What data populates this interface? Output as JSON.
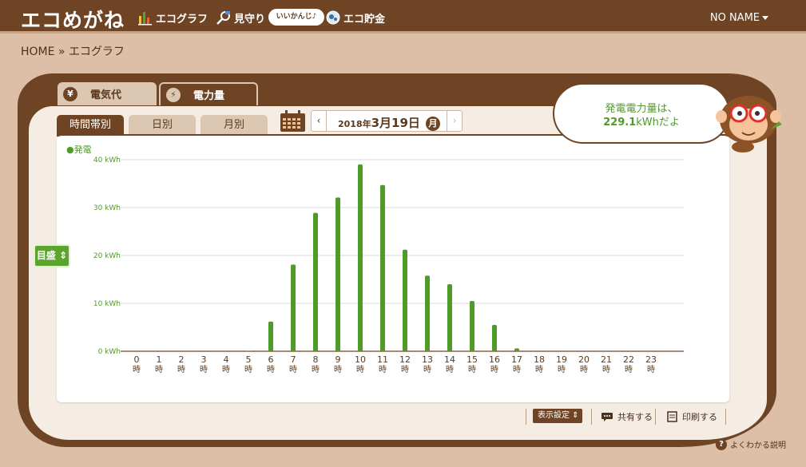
{
  "header": {
    "logo": "エコめがね",
    "nav": [
      {
        "label": "エコグラフ",
        "icon": "bar-chart-icon"
      },
      {
        "label": "見守り",
        "icon": "magnifier-icon"
      },
      {
        "label": "エコ貯金",
        "icon": "piggy-bank-icon"
      }
    ],
    "status_pill": "いいかんじ♪",
    "user": "NO NAME"
  },
  "breadcrumb": "HOME » エコグラフ",
  "main_tabs": [
    {
      "label": "電気代",
      "icon": "yen-icon"
    },
    {
      "label": "電力量",
      "icon": "lightning-icon"
    }
  ],
  "sub_tabs": [
    "時間帯別",
    "日別",
    "月別"
  ],
  "date": {
    "year": "2018年",
    "monthday": "3月19日",
    "dow": "月"
  },
  "bubble": {
    "line1": "発電電力量は、",
    "value": "229.1",
    "unit": "kWh",
    "suffix": "だよ"
  },
  "scale_button": "目盛",
  "colors": {
    "brand": "#6e4424",
    "accent": "#5da42d",
    "bar": "#4f9a28"
  },
  "chart_data": {
    "type": "bar",
    "legend": "●発電",
    "categories": [
      "0",
      "1",
      "2",
      "3",
      "4",
      "5",
      "6",
      "7",
      "8",
      "9",
      "10",
      "11",
      "12",
      "13",
      "14",
      "15",
      "16",
      "17",
      "18",
      "19",
      "20",
      "21",
      "22",
      "23"
    ],
    "category_suffix": "時",
    "series": [
      {
        "name": "発電",
        "values": [
          0,
          0,
          0,
          0,
          0,
          0.1,
          6.2,
          18.1,
          28.9,
          32.1,
          39.0,
          34.7,
          21.2,
          15.8,
          14.0,
          10.5,
          5.5,
          0.6,
          0,
          0,
          0,
          0,
          0,
          0
        ]
      }
    ],
    "yticks": [
      "0 kWh",
      "10 kWh",
      "20 kWh",
      "30 kWh",
      "40 kWh"
    ],
    "ylim": [
      0,
      40
    ],
    "grid": true
  },
  "footer": {
    "display_settings": "表示設定",
    "share": "共有する",
    "print": "印刷する",
    "help": "よくわかる説明"
  }
}
